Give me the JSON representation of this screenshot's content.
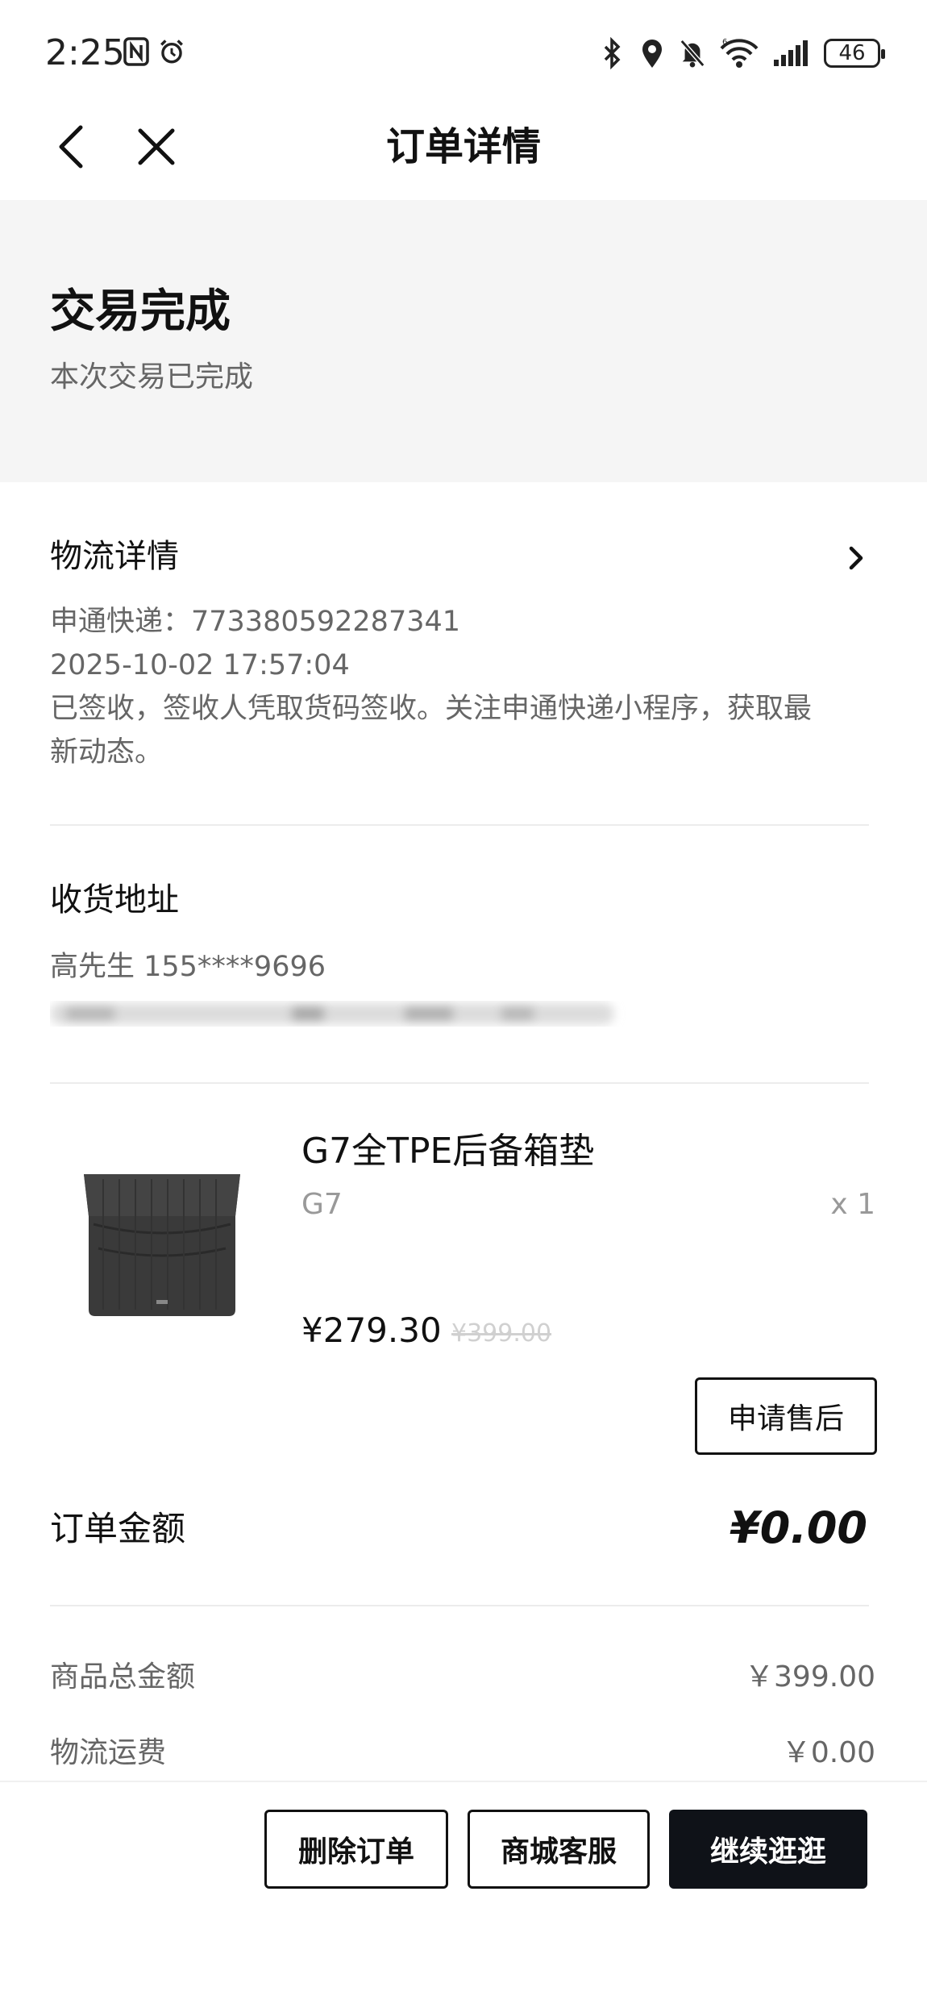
{
  "status_bar": {
    "time": "2:25",
    "battery": "46",
    "left_icons": [
      "nfc-icon",
      "alarm-icon"
    ],
    "right_icons": [
      "bluetooth-icon",
      "location-icon",
      "mute-icon",
      "wifi-icon",
      "signal-icon"
    ]
  },
  "header": {
    "title": "订单详情"
  },
  "order_status": {
    "title": "交易完成",
    "subtitle": "本次交易已完成"
  },
  "logistics": {
    "title": "物流详情",
    "carrier_line": "申通快递：773380592287341",
    "time": "2025-10-02 17:57:04",
    "message_line1": "已签收，签收人凭取货码签收。关注申通快递小程序，获取最",
    "message_line2": "新动态。"
  },
  "address": {
    "title": "收货地址",
    "contact": "高先生  155****9696"
  },
  "product": {
    "name": "G7全TPE后备箱垫",
    "variant": "G7",
    "quantity": "x 1",
    "price": "¥279.30",
    "original_price": "¥399.00",
    "aftersale_label": "申请售后"
  },
  "summary": {
    "order_amount_label": "订单金额",
    "order_amount_value": "¥0.00",
    "rows": [
      {
        "label": "商品总金额",
        "value": "￥399.00"
      },
      {
        "label": "物流运费",
        "value": "￥0.00"
      }
    ]
  },
  "bottom_bar": {
    "delete_label": "删除订单",
    "service_label": "商城客服",
    "continue_label": "继续逛逛"
  }
}
